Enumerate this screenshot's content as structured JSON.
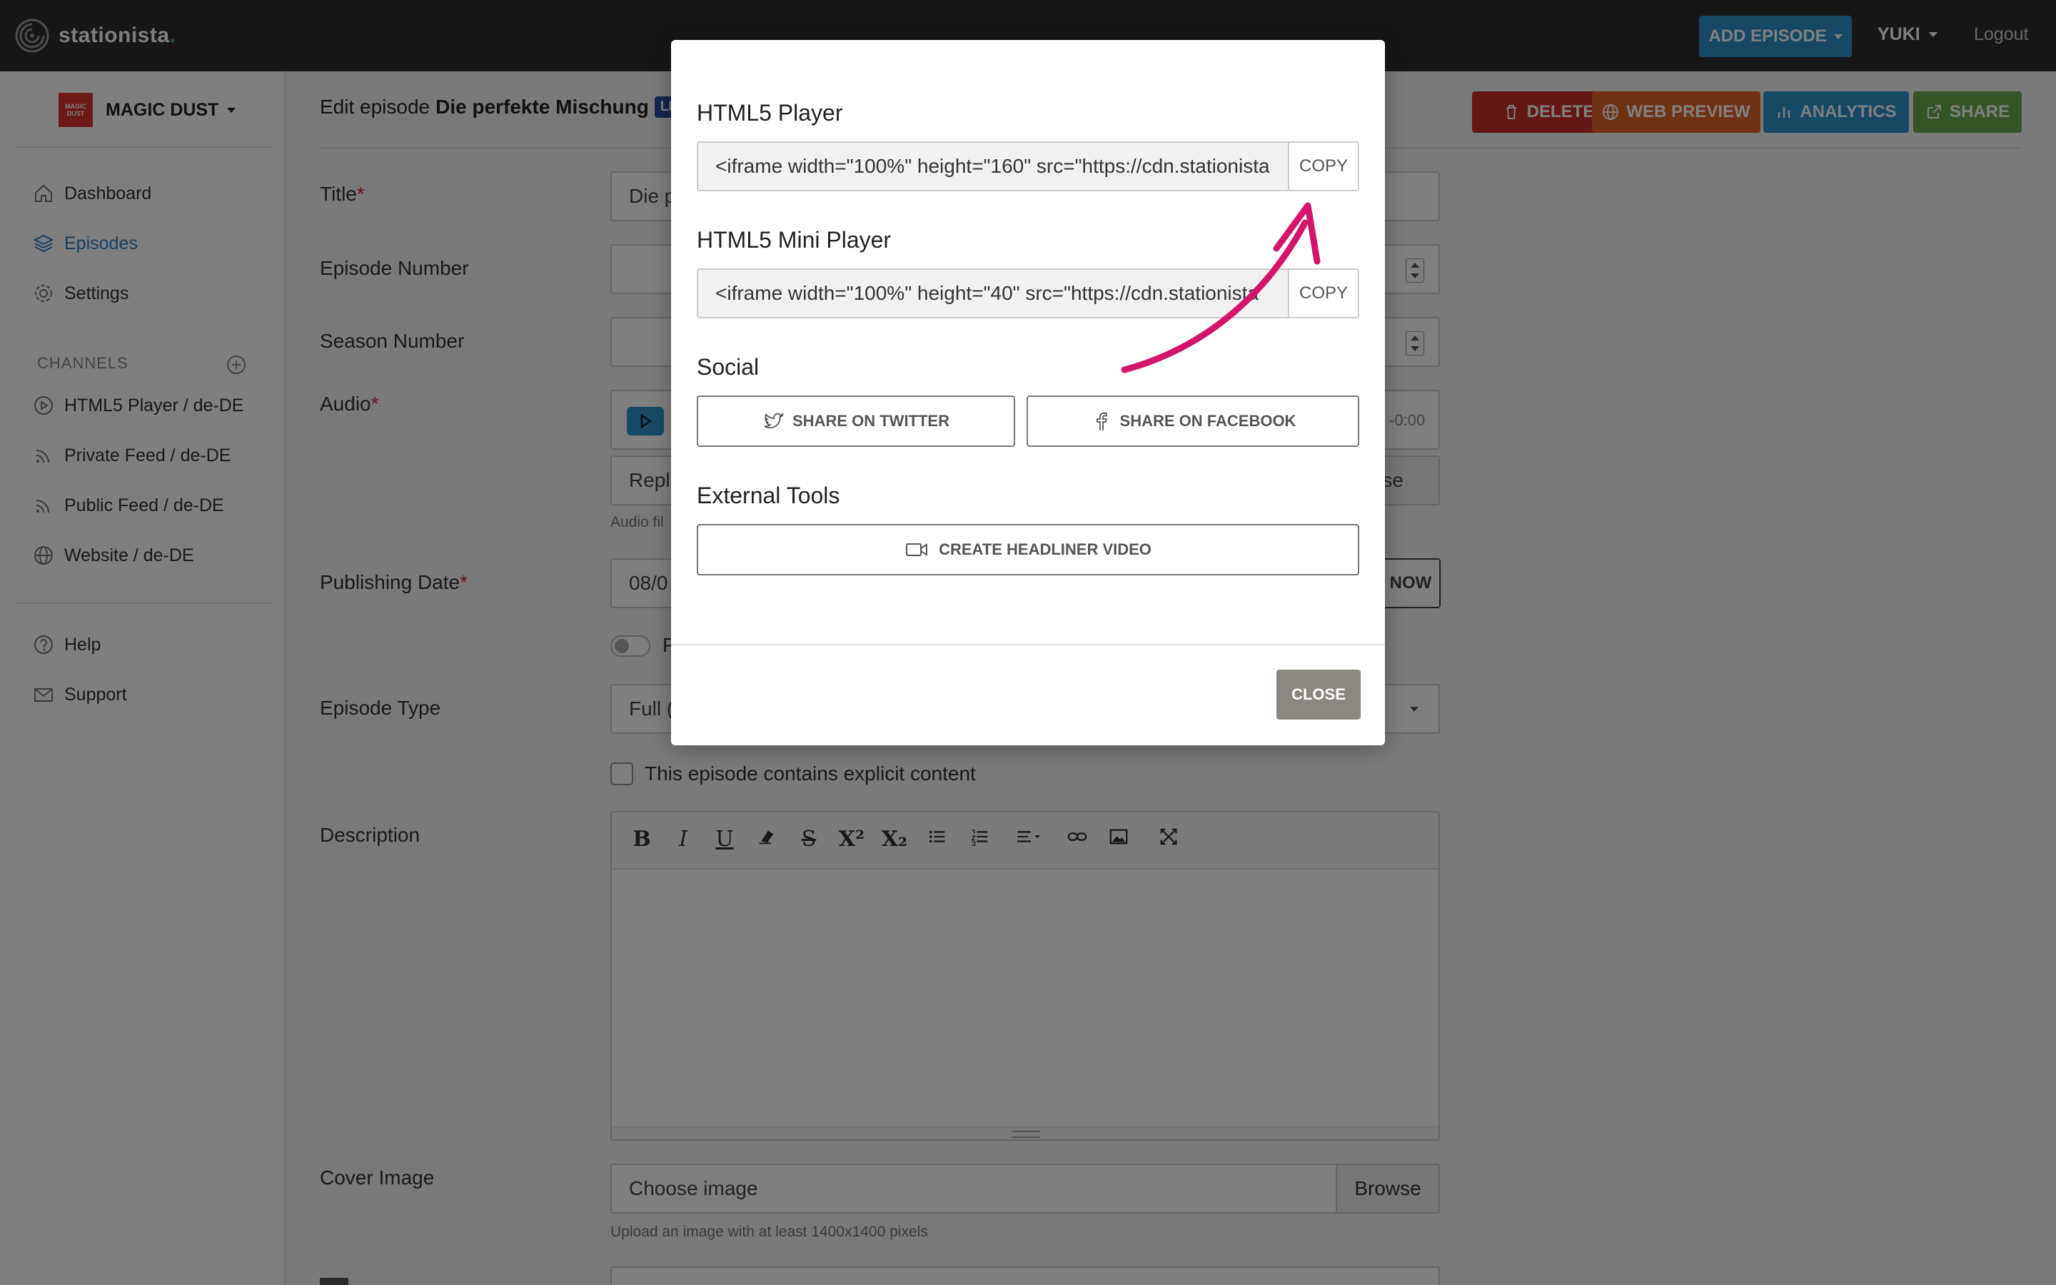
{
  "navbar": {
    "logo_text": "stationista",
    "logo_dot": ".",
    "add_episode_label": "ADD EPISODE",
    "user_label": "YUKI",
    "logout_label": "Logout"
  },
  "sidebar": {
    "podcast_name": "MAGIC DUST",
    "podcast_logo_text": "MAGIC DUST",
    "nav": [
      {
        "label": "Dashboard",
        "icon": "home-icon"
      },
      {
        "label": "Episodes",
        "icon": "layers-icon",
        "active": true
      },
      {
        "label": "Settings",
        "icon": "gear-icon"
      }
    ],
    "channels_heading": "CHANNELS",
    "channels": [
      {
        "label": "HTML5 Player / de-DE",
        "icon": "play-circle-icon"
      },
      {
        "label": "Private Feed / de-DE",
        "icon": "rss-icon"
      },
      {
        "label": "Public Feed / de-DE",
        "icon": "rss-icon"
      },
      {
        "label": "Website / de-DE",
        "icon": "globe-icon"
      }
    ],
    "support": [
      {
        "label": "Help",
        "icon": "question-icon"
      },
      {
        "label": "Support",
        "icon": "mail-icon"
      }
    ]
  },
  "main": {
    "title_prefix": "Edit episode",
    "title_name": "Die perfekte Mischung",
    "live_badge": "LIV",
    "actions": {
      "delete": "DELETE",
      "web_preview": "WEB PREVIEW",
      "analytics": "ANALYTICS",
      "share": "SHARE"
    },
    "colors": {
      "delete": "#c9302c",
      "web_preview": "#e0652a",
      "analytics": "#2e93c9",
      "share": "#6aa84f"
    },
    "fields": {
      "title_label": "Title",
      "title_value": "Die p",
      "episode_number_label": "Episode Number",
      "season_number_label": "Season Number",
      "audio_label": "Audio",
      "audio_time": "-0:00",
      "replace_value": "Repla",
      "replace_browse": "wse",
      "audio_hint": "Audio fil",
      "publishing_date_label": "Publishing Date",
      "publishing_date_value": "08/0",
      "now_label": "NOW",
      "toggle_label": "P",
      "episode_type_label": "Episode Type",
      "episode_type_value": "Full (",
      "explicit_label": "This episode contains explicit content",
      "description_label": "Description",
      "cover_label": "Cover Image",
      "cover_placeholder": "Choose image",
      "cover_browse": "Browse",
      "cover_hint": "Upload an image with at least 1400x1400 pixels"
    },
    "toolbar": [
      "B",
      "I",
      "U",
      "eraser",
      "S",
      "X²",
      "X₂",
      "ul",
      "ol",
      "align",
      "link",
      "image",
      "fullscreen"
    ],
    "required_mark": "*"
  },
  "modal": {
    "html5_heading": "HTML5 Player",
    "html5_code": "<iframe width=\"100%\" height=\"160\" src=\"https://cdn.stationista",
    "mini_heading": "HTML5 Mini Player",
    "mini_code": "<iframe width=\"100%\" height=\"40\" src=\"https://cdn.stationista",
    "copy_label": "COPY",
    "social_heading": "Social",
    "share_twitter": "SHARE ON TWITTER",
    "share_facebook": "SHARE ON FACEBOOK",
    "tools_heading": "External Tools",
    "headliner": "CREATE HEADLINER VIDEO",
    "close_label": "CLOSE",
    "arrow_color": "#d4146a"
  }
}
